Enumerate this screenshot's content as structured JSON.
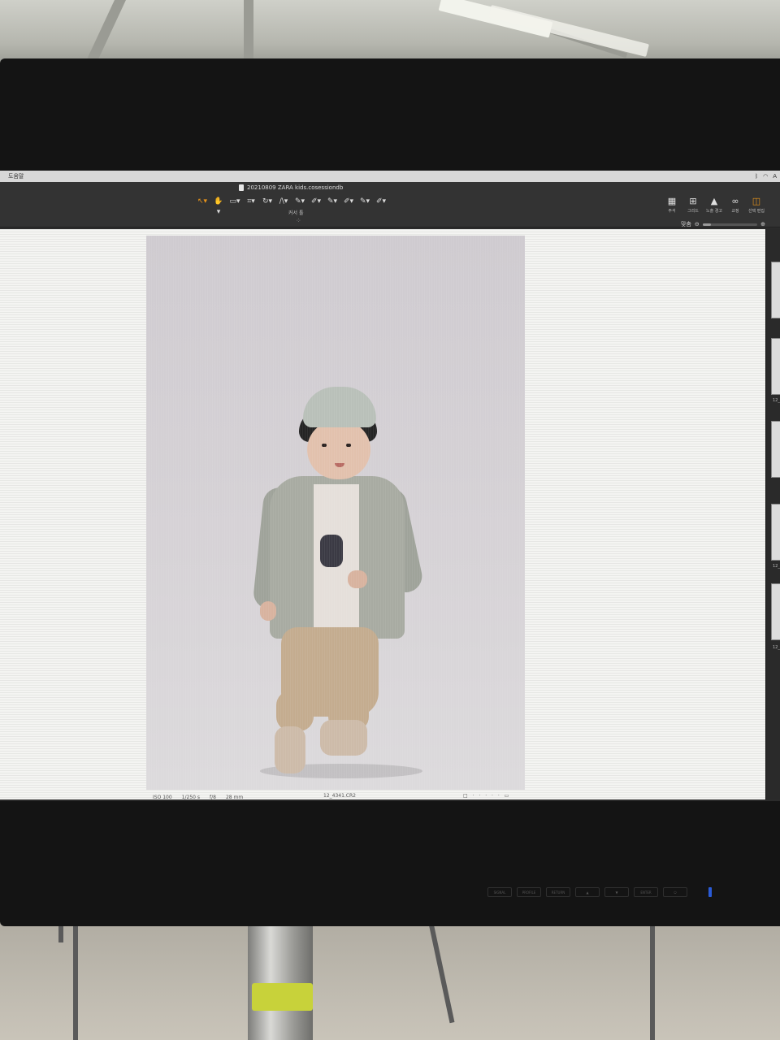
{
  "menubar": {
    "left_label": "도움말"
  },
  "toolbar": {
    "doc_title": "20210809 ZARA kids.cosessiondb",
    "tool_caption": "커서 툴",
    "tools": [
      "↖▾",
      "✋▾",
      "▭▾",
      "⌗▾",
      "↻▾",
      "/\\▾",
      "✎▾",
      "✐▾",
      "✎▾",
      "✐▾",
      "✎▾",
      "✐▾"
    ],
    "right_tools": [
      {
        "icon": "▦",
        "label": "주석"
      },
      {
        "icon": "⊞",
        "label": "그리드"
      },
      {
        "icon": "▲",
        "label": "노출 경고"
      },
      {
        "icon": "∞",
        "label": "교정"
      },
      {
        "icon": "◫",
        "label": "선택 편집"
      }
    ],
    "zoom_label": "맞춤",
    "zoom_level": 0.15
  },
  "viewer": {
    "exif": [
      "ISO 100",
      "1/250 s",
      "f/8",
      "28 mm"
    ],
    "filename": "12_4341.CR2",
    "rating": "□ · · · · · ▭"
  },
  "filmstrip": {
    "thumb_label": "12_"
  },
  "monitor_buttons": [
    "SIGNAL",
    "PROFILE",
    "RETURN",
    "▲",
    "▼",
    "ENTER",
    "⏻"
  ]
}
